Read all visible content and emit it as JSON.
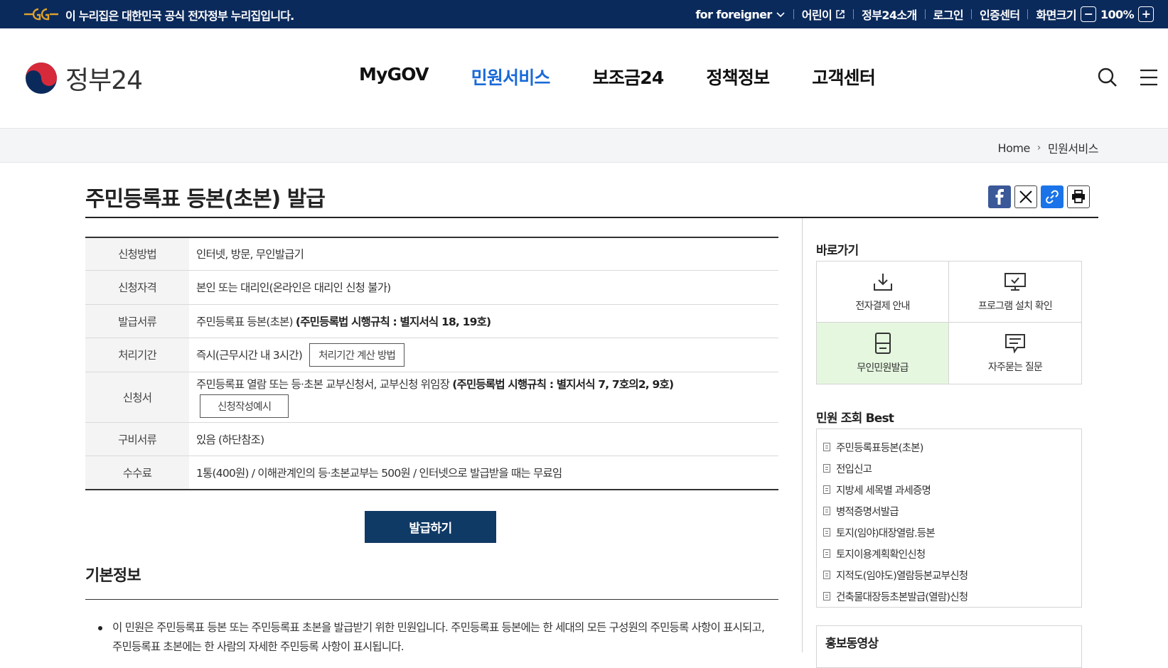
{
  "topbar": {
    "notice": "이 누리집은 대한민국 공식 전자정부 누리집입니다.",
    "foreigner": "for foreigner",
    "kids": "어린이",
    "about": "정부24소개",
    "login": "로그인",
    "cert": "인증센터",
    "screen_size": "화면크기",
    "zoom_minus": "−",
    "zoom_level": "100%",
    "zoom_plus": "+"
  },
  "header": {
    "logo_text": "정부24",
    "nav": [
      "MyGOV",
      "민원서비스",
      "보조금24",
      "정책정보",
      "고객센터"
    ],
    "active_nav": "민원서비스"
  },
  "breadcrumb": {
    "home": "Home",
    "current": "민원서비스"
  },
  "page": {
    "title": "주민등록표 등본(초본) 발급"
  },
  "info": {
    "method_label": "신청방법",
    "method_value": "인터넷, 방문, 무인발급기",
    "eligibility_label": "신청자격",
    "eligibility_value": "본인 또는 대리인(온라인은 대리인 신청 불가)",
    "document_label": "발급서류",
    "document_value": "주민등록표 등본(초본)",
    "document_law": "(주민등록법 시행규칙 : 별지서식 18, 19호)",
    "period_label": "처리기간",
    "period_value": "즉시(근무시간 내 3시간)",
    "period_button": "처리기간 계산 방법",
    "form_label": "신청서",
    "form_value": "주민등록표 열람 또는 등·초본 교부신청서, 교부신청 위임장",
    "form_law": "(주민등록법 시행규칙 : 별지서식 7, 7호의2, 9호)",
    "form_button": "신청작성예시",
    "docs_label": "구비서류",
    "docs_value": "있음 (하단참조)",
    "fee_label": "수수료",
    "fee_value": "1통(400원) / 이해관계인의 등·초본교부는 500원 / 인터넷으로 발급받을 때는 무료임"
  },
  "issue_button": "발급하기",
  "basic": {
    "title": "기본정보",
    "text": "이 민원은 주민등록표 등본 또는 주민등록표 초본을 발급받기 위한 민원입니다. 주민등록표 등본에는 한 세대의 모든 구성원의 주민등록 사항이 표시되고, 주민등록표 초본에는 한 사람의 자세한 주민등록 사항이 표시됩니다."
  },
  "sidebar": {
    "quick_title": "바로가기",
    "quick": [
      "전자결제 안내",
      "프로그램 설치 확인",
      "무인민원발급",
      "자주묻는 질문"
    ],
    "best_title": "민원 조회 Best",
    "best": [
      "주민등록표등본(초본)",
      "전입신고",
      "지방세 세목별 과세증명",
      "병적증명서발급",
      "토지(임야)대장열람.등본",
      "토지이용계획확인신청",
      "지적도(임야도)열람등본교부신청",
      "건축물대장등초본발급(열람)신청"
    ],
    "promo_title": "홍보동영상"
  },
  "colors": {
    "topbar": "#0b2a5c",
    "active_nav": "#1a6ad8",
    "issue_button": "#103a66",
    "highlight": "#e5f7df"
  }
}
